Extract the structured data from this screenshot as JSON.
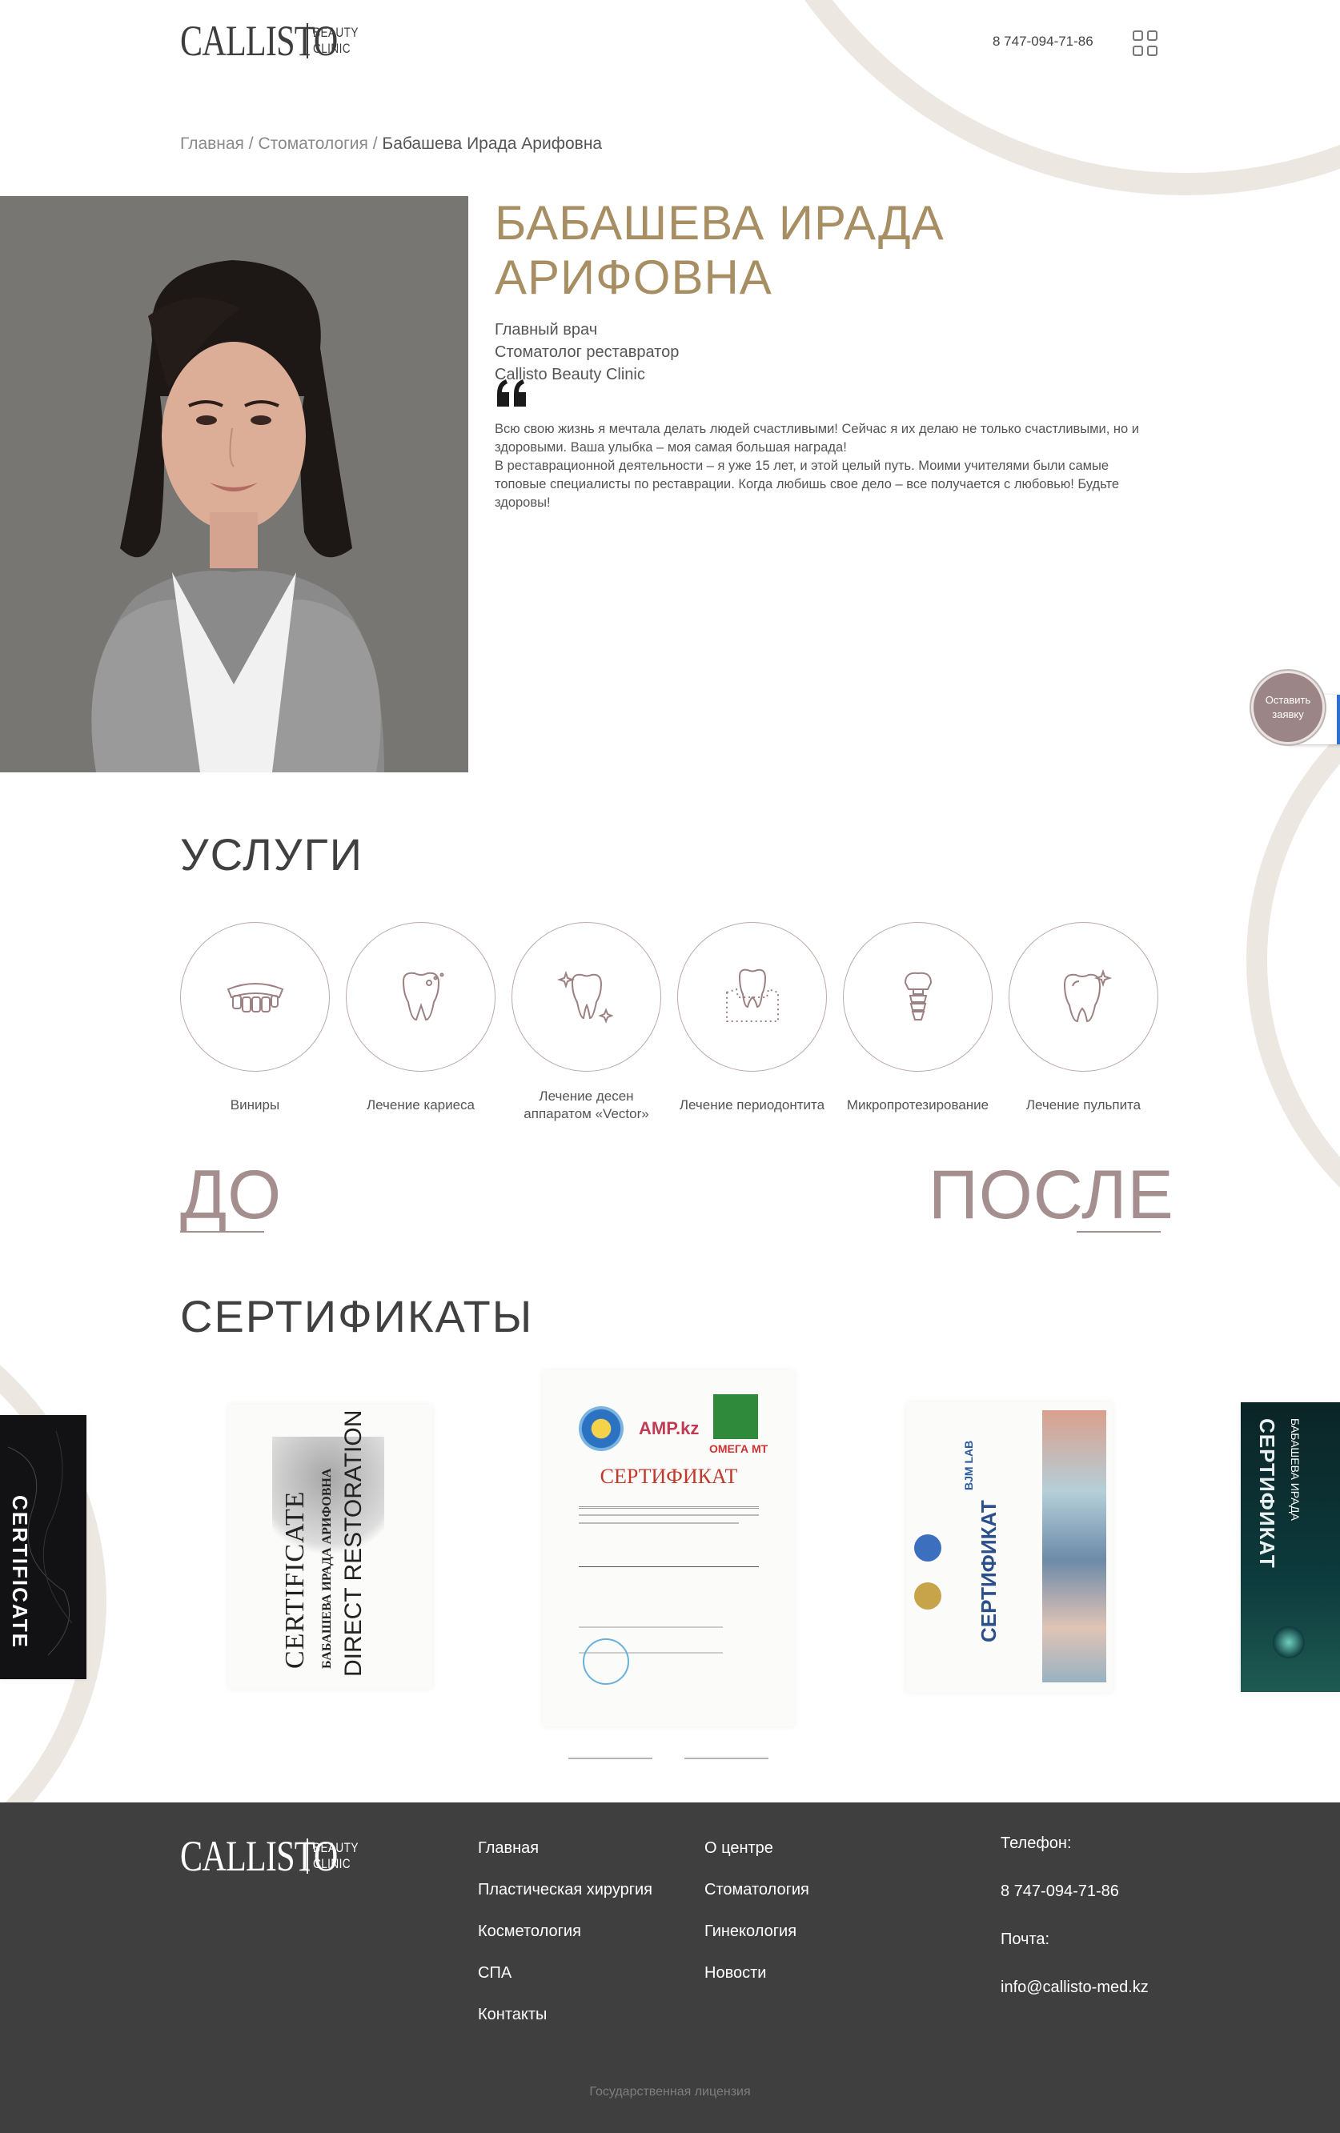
{
  "brand": {
    "name": "CALLISTO",
    "sub_line1": "BEAUTY",
    "sub_line2": "CLINIC"
  },
  "header": {
    "phone": "8 747-094-71-86",
    "menu_icon": "grid-menu-icon"
  },
  "breadcrumb": {
    "home": "Главная",
    "section": "Стоматология",
    "current": "Бабашева Ирада Арифовна",
    "separator": "/"
  },
  "doctor": {
    "name_line1": "БАБАШЕВА ИРАДА",
    "name_line2": "АРИФОВНА",
    "role1": "Главный врач",
    "role2": "Стоматолог реставратор",
    "role3": "Callisto Beauty Clinic",
    "quote": "Всю свою жизнь я мечтала делать людей счастливыми! Сейчас я их делаю не только счастливыми, но и здоровыми. Ваша улыбка – моя самая большая награда!",
    "bio": "В реставрационной деятельности – я уже 15 лет, и этой целый путь. Моими учителями были самые топовые специалисты по реставрации. Когда любишь свое дело – все получается с любовью! Будьте здоровы!"
  },
  "cta": {
    "label": "Оставить заявку"
  },
  "services": {
    "title": "УСЛУГИ",
    "items": [
      {
        "label": "Виниры",
        "icon": "veneers-icon"
      },
      {
        "label": "Лечение кариеса",
        "icon": "caries-tooth-icon"
      },
      {
        "label": "Лечение десен аппаратом «Vector»",
        "icon": "sparkle-tooth-icon"
      },
      {
        "label": "Лечение периодонтита",
        "icon": "gum-tooth-icon"
      },
      {
        "label": "Микропротезирование",
        "icon": "implant-icon"
      },
      {
        "label": "Лечение пульпита",
        "icon": "shiny-tooth-icon"
      }
    ]
  },
  "before_after": {
    "before": "ДО",
    "after": "ПОСЛЕ"
  },
  "certificates": {
    "title": "СЕРТИФИКАТЫ",
    "items": [
      {
        "title": "CERTIFICATE",
        "variant": "dark"
      },
      {
        "title": "CERTIFICATE",
        "name": "БАБАШЕВА ИРАДА АРИФОВНА",
        "course": "DIRECT RESTORATION",
        "variant": "light-rotated"
      },
      {
        "logos": [
          "AMP.kz",
          "ОМЕГА МТ"
        ],
        "title": "СЕРТИФИКАТ",
        "variant": "light"
      },
      {
        "logos": [
          "BJM LAB"
        ],
        "title": "СЕРТИФИКАТ",
        "variant": "light-rotated"
      },
      {
        "title": "СЕРТИФИКАТ",
        "name": "БАБАШЕВА ИРАДА",
        "variant": "dark-rotated"
      }
    ]
  },
  "footer": {
    "col1": [
      "Главная",
      "Пластическая хирургия",
      "Косметология",
      "СПА",
      "Контакты"
    ],
    "col2": [
      "О центре",
      "Стоматология",
      "Гинекология",
      "Новости"
    ],
    "phone_label": "Телефон:",
    "phone": "8 747-094-71-86",
    "email_label": "Почта:",
    "email": "info@callisto-med.kz",
    "license": "Государственная лицензия"
  },
  "colors": {
    "gold": "#a78e63",
    "mauve": "#9b8587",
    "footer_bg": "#3f3f3f",
    "deco_beige": "#ece8e1"
  }
}
